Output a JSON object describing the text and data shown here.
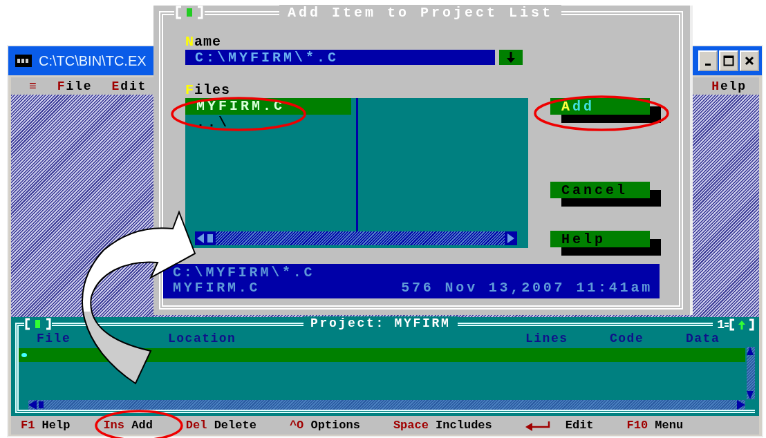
{
  "console_window": {
    "title": "C:\\TC\\BIN\\TC.EX"
  },
  "menu": [
    {
      "label": "≡"
    },
    {
      "label": "File"
    },
    {
      "label": "Edit"
    },
    {
      "label": "Help"
    }
  ],
  "dialog": {
    "title": "Add Item to Project List",
    "name_label": "Name",
    "name_value": "C:\\MYFIRM\\*.C",
    "files_label": "Files",
    "files": [
      {
        "name": "MYFIRM.C",
        "selected": true
      },
      {
        "name": "..\\",
        "selected": false
      }
    ],
    "buttons": [
      {
        "label": "Add",
        "focused": true
      },
      {
        "label": "Cancel",
        "focused": false
      },
      {
        "label": "Help",
        "focused": false
      }
    ],
    "info": {
      "path": "C:\\MYFIRM\\*.C",
      "file": "MYFIRM.C",
      "size": "576",
      "date": "Nov 13,2007",
      "time": "11:41am"
    }
  },
  "project_window": {
    "title": "Project: MYFIRM",
    "number": "1",
    "columns": [
      "File",
      "Location",
      "Lines",
      "Code",
      "Data"
    ]
  },
  "status_bar": [
    {
      "kind": "key",
      "key": "F1",
      "action": "Help"
    },
    {
      "kind": "key",
      "key": "Ins",
      "action": "Add"
    },
    {
      "kind": "key",
      "key": "Del",
      "action": "Delete"
    },
    {
      "kind": "key",
      "key": "^O",
      "action": "Options"
    },
    {
      "kind": "key",
      "key": "Space",
      "action": "Includes"
    },
    {
      "kind": "enter",
      "action": "Edit"
    },
    {
      "kind": "key",
      "key": "F10",
      "action": "Menu"
    }
  ]
}
